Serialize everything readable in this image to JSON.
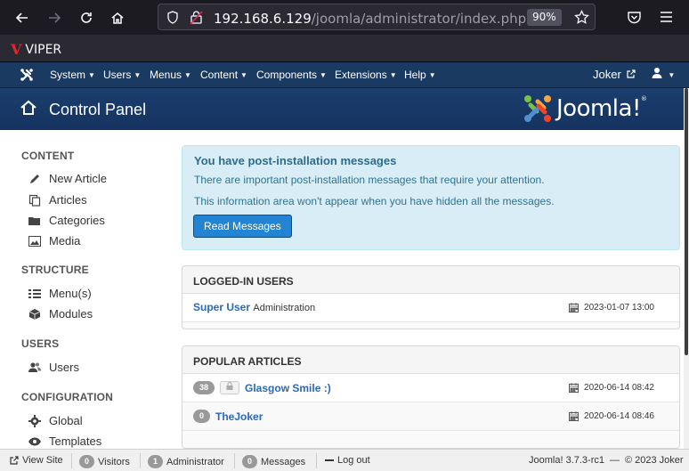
{
  "browser": {
    "url_host": "192.168.6.129",
    "url_path": "/joomla/administrator/index.php",
    "zoom": "90%",
    "bookmark_label": "VIPER",
    "bookmark_logo": "V"
  },
  "admin_nav": {
    "items": [
      "System",
      "Users",
      "Menus",
      "Content",
      "Components",
      "Extensions",
      "Help"
    ],
    "user_link": "Joker"
  },
  "header": {
    "title": "Control Panel",
    "logo_text": "Joomla!",
    "logo_mark": "®"
  },
  "sidebar": {
    "sections": [
      {
        "heading": "CONTENT",
        "items": [
          "New Article",
          "Articles",
          "Categories",
          "Media"
        ]
      },
      {
        "heading": "STRUCTURE",
        "items": [
          "Menu(s)",
          "Modules"
        ]
      },
      {
        "heading": "USERS",
        "items": [
          "Users"
        ]
      },
      {
        "heading": "CONFIGURATION",
        "items": [
          "Global",
          "Templates"
        ]
      }
    ]
  },
  "alert": {
    "title": "You have post-installation messages",
    "line1": "There are important post-installation messages that require your attention.",
    "line2": "This information area won't appear when you have hidden all the messages.",
    "button": "Read Messages"
  },
  "logged_in": {
    "heading": "LOGGED-IN USERS",
    "rows": [
      {
        "name": "Super User",
        "area": "Administration",
        "date": "2023-01-07 13:00"
      }
    ]
  },
  "popular": {
    "heading": "POPULAR ARTICLES",
    "rows": [
      {
        "hits": "38",
        "title": "Glasgow Smile :)",
        "date": "2020-06-14 08:42"
      },
      {
        "hits": "0",
        "title": "TheJoker",
        "date": "2020-06-14 08:46"
      }
    ]
  },
  "status": {
    "view_site": "View Site",
    "visitors_count": "0",
    "visitors_label": "Visitors",
    "admin_count": "1",
    "admin_label": "Administrator",
    "messages_count": "0",
    "messages_label": "Messages",
    "logout": "Log out",
    "version": "Joomla! 3.7.3-rc1",
    "separator": "—",
    "copyright": "© 2023 Joker"
  },
  "colors": {
    "nav_bg": "#1b3a62",
    "header_bg": "#1a3867",
    "alert_bg": "#d9edf7",
    "button_blue": "#2384d3",
    "link_blue": "#2a69b8"
  }
}
